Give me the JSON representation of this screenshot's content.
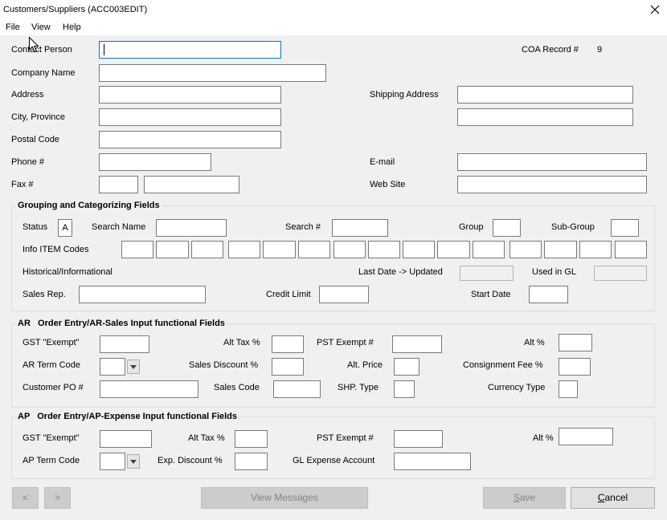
{
  "window": {
    "title": "Customers/Suppliers (ACC003EDIT)",
    "close_icon": "close-icon"
  },
  "menu": {
    "file": "File",
    "view": "View",
    "help": "Help"
  },
  "header": {
    "coa_record_label": "COA Record #",
    "coa_record_value": "9"
  },
  "contact": {
    "contact_person": {
      "label": "Contact Person",
      "value": ""
    },
    "company_name": {
      "label": "Company Name",
      "value": ""
    },
    "address": {
      "label": "Address",
      "value": ""
    },
    "city_province": {
      "label": "City, Province",
      "value": ""
    },
    "postal_code": {
      "label": "Postal Code",
      "value": ""
    },
    "phone": {
      "label": "Phone #",
      "value": ""
    },
    "fax": {
      "label": "Fax #",
      "value_1": "",
      "value_2": ""
    },
    "shipping_address": {
      "label": "Shipping Address",
      "line_1": "",
      "line_2": ""
    },
    "email": {
      "label": "E-mail",
      "value": ""
    },
    "web_site": {
      "label": "Web Site",
      "value": ""
    }
  },
  "grouping": {
    "title": "Grouping and Categorizing Fields",
    "status": {
      "label": "Status",
      "value": "A"
    },
    "search_name": {
      "label": "Search Name",
      "value": ""
    },
    "search_number": {
      "label": "Search #",
      "value": ""
    },
    "group": {
      "label": "Group",
      "value": ""
    },
    "sub_group": {
      "label": "Sub-Group",
      "value": ""
    },
    "info_item_codes": {
      "label": "Info ITEM Codes",
      "values": [
        "",
        "",
        "",
        "",
        "",
        "",
        "",
        "",
        "",
        "",
        "",
        "",
        "",
        "",
        ""
      ]
    },
    "historical_label": "Historical/Informational",
    "last_date_updated": {
      "label": "Last Date -> Updated",
      "value": ""
    },
    "used_in_gl": {
      "label": "Used in GL",
      "value": ""
    },
    "sales_rep": {
      "label": "Sales Rep.",
      "value": ""
    },
    "credit_limit": {
      "label": "Credit Limit",
      "value": ""
    },
    "start_date": {
      "label": "Start Date",
      "value": ""
    }
  },
  "ar": {
    "title": "AR   Order Entry/AR-Sales Input functional Fields",
    "gst_exempt": {
      "label": "GST \"Exempt\"",
      "value": ""
    },
    "alt_tax": {
      "label": "Alt Tax %",
      "value": ""
    },
    "pst_exempt": {
      "label": "PST Exempt #",
      "value": ""
    },
    "alt_pct": {
      "label": "Alt %",
      "value": ""
    },
    "term_code": {
      "label": "AR Term Code",
      "value": ""
    },
    "sales_discount": {
      "label": "Sales Discount %",
      "value": ""
    },
    "alt_price": {
      "label": "Alt. Price",
      "value": ""
    },
    "consignment_fee": {
      "label": "Consignment Fee %",
      "value": ""
    },
    "customer_po": {
      "label": "Customer PO #",
      "value": ""
    },
    "sales_code": {
      "label": "Sales Code",
      "value": ""
    },
    "shp_type": {
      "label": "SHP. Type",
      "value": ""
    },
    "currency_type": {
      "label": "Currency Type",
      "value": ""
    }
  },
  "ap": {
    "title": "AP   Order Entry/AP-Expense Input functional Fields",
    "gst_exempt": {
      "label": "GST \"Exempt\"",
      "value": ""
    },
    "alt_tax": {
      "label": "Alt Tax %",
      "value": ""
    },
    "pst_exempt": {
      "label": "PST Exempt #",
      "value": ""
    },
    "alt_pct": {
      "label": "Alt %",
      "value": ""
    },
    "term_code": {
      "label": "AP Term Code",
      "value": ""
    },
    "exp_discount": {
      "label": "Exp. Discount %",
      "value": ""
    },
    "gl_expense_account": {
      "label": "GL Expense Account",
      "value": ""
    }
  },
  "dropdown_icon": "chevron-down-icon",
  "buttons": {
    "prev": {
      "label": "<",
      "enabled": false
    },
    "next": {
      "label": ">",
      "enabled": false
    },
    "view_messages": {
      "label": "View Messages",
      "enabled": false
    },
    "save": {
      "label": "Save",
      "enabled": false
    },
    "cancel": {
      "label": "Cancel",
      "enabled": true
    }
  },
  "colors": {
    "window_bg": "#f0f0f0",
    "focus_border": "#0078d7",
    "input_border": "#7a7a7a",
    "button_bg": "#e1e1e1",
    "disabled_button_bg": "#cccccc"
  }
}
